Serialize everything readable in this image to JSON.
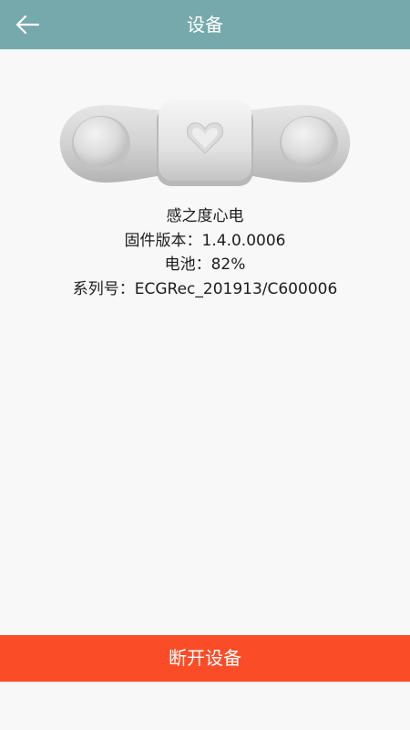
{
  "header": {
    "title": "设备",
    "back_icon": "arrow-left-icon"
  },
  "device": {
    "image_icon": "ecg-device-icon",
    "name": "感之度心电",
    "firmware": "固件版本：1.4.0.0006",
    "battery": "电池：82%",
    "serial": "系列号：ECGRec_201913/C600006"
  },
  "actions": {
    "disconnect_label": "断开设备"
  },
  "colors": {
    "header_bg": "#76a9ac",
    "disconnect_bg": "#fb4c28"
  }
}
